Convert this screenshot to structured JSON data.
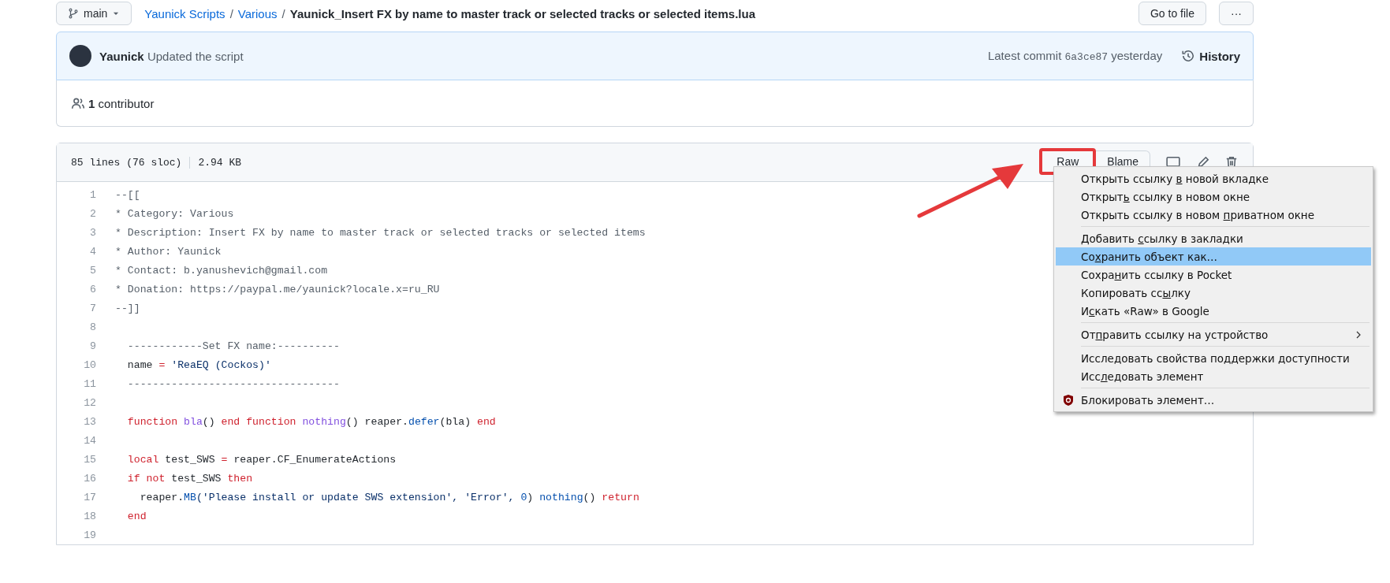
{
  "top_bar": {
    "branch": "main",
    "breadcrumb": [
      {
        "label": "Yaunick Scripts",
        "kind": "link"
      },
      {
        "label": "/",
        "kind": "separator"
      },
      {
        "label": "Various",
        "kind": "link"
      },
      {
        "label": "/",
        "kind": "separator"
      },
      {
        "label": "Yaunick_Insert FX by name to master track or selected tracks or selected items.lua",
        "kind": "current"
      }
    ],
    "goto_button": "Go to file",
    "more_button": "···"
  },
  "commit": {
    "author": "Yaunick",
    "message": "Updated the script",
    "latest_label": "Latest commit",
    "sha": "6a3ce87",
    "time": "yesterday",
    "history": "History"
  },
  "contributors": {
    "count": "1",
    "label": "contributor"
  },
  "file": {
    "lines_info": "85 lines (76 sloc)",
    "size": "2.94 KB",
    "buttons": [
      {
        "label": "Raw",
        "highlighted": true
      },
      {
        "label": "Blame",
        "highlighted": false
      }
    ],
    "code": [
      {
        "number": "1",
        "tokens": [
          {
            "t": "--[[",
            "kind": "comment"
          }
        ]
      },
      {
        "number": "2",
        "tokens": [
          {
            "t": "* Category: Various",
            "kind": "comment"
          }
        ]
      },
      {
        "number": "3",
        "tokens": [
          {
            "t": "* Description: Insert FX by name to master track or selected tracks or selected items",
            "kind": "comment"
          }
        ]
      },
      {
        "number": "4",
        "tokens": [
          {
            "t": "* Author: Yaunick",
            "kind": "comment"
          }
        ]
      },
      {
        "number": "5",
        "tokens": [
          {
            "t": "* Contact: b.yanushevich@gmail.com",
            "kind": "comment"
          }
        ]
      },
      {
        "number": "6",
        "tokens": [
          {
            "t": "* Donation: https://paypal.me/yaunick?locale.x=ru_RU",
            "kind": "comment"
          }
        ]
      },
      {
        "number": "7",
        "tokens": [
          {
            "t": "--]]",
            "kind": "comment"
          }
        ]
      },
      {
        "number": "8"
      },
      {
        "number": "9",
        "tokens": [
          {
            "t": "  ------------Set FX name:----------",
            "kind": "comment"
          }
        ]
      },
      {
        "number": "10",
        "tokens": [
          {
            "t": "  name ",
            "kind": "plain"
          },
          {
            "t": "=",
            "kind": "keyword"
          },
          {
            "t": " 'ReaEQ (Cockos)'",
            "kind": "string"
          }
        ]
      },
      {
        "number": "11",
        "tokens": [
          {
            "t": "  ----------------------------------",
            "kind": "comment"
          }
        ]
      },
      {
        "number": "12"
      },
      {
        "number": "13",
        "tokens": [
          {
            "t": "  function",
            "kind": "keyword"
          },
          {
            "t": " bla",
            "kind": "entity"
          },
          {
            "t": "() ",
            "kind": "plain"
          },
          {
            "t": "end function",
            "kind": "keyword"
          },
          {
            "t": " nothing",
            "kind": "entity"
          },
          {
            "t": "() reaper.",
            "kind": "plain"
          },
          {
            "t": "defer",
            "kind": "constant"
          },
          {
            "t": "(bla) ",
            "kind": "plain"
          },
          {
            "t": "end",
            "kind": "keyword"
          }
        ]
      },
      {
        "number": "14"
      },
      {
        "number": "15",
        "tokens": [
          {
            "t": "  local",
            "kind": "keyword"
          },
          {
            "t": " test_SWS ",
            "kind": "plain"
          },
          {
            "t": "=",
            "kind": "keyword"
          },
          {
            "t": " reaper.CF_EnumerateActions",
            "kind": "plain"
          }
        ]
      },
      {
        "number": "16",
        "tokens": [
          {
            "t": "  if not",
            "kind": "keyword"
          },
          {
            "t": " test_SWS ",
            "kind": "plain"
          },
          {
            "t": "then",
            "kind": "keyword"
          }
        ]
      },
      {
        "number": "17",
        "tokens": [
          {
            "t": "    reaper.",
            "kind": "plain"
          },
          {
            "t": "MB",
            "kind": "constant"
          },
          {
            "t": "('Please install or update SWS extension', 'Error', ",
            "kind": "string"
          },
          {
            "t": "0",
            "kind": "constant"
          },
          {
            "t": ") ",
            "kind": "plain"
          },
          {
            "t": "nothing",
            "kind": "constant"
          },
          {
            "t": "() ",
            "kind": "plain"
          },
          {
            "t": "return",
            "kind": "keyword"
          }
        ]
      },
      {
        "number": "18",
        "tokens": [
          {
            "t": "  end",
            "kind": "keyword"
          }
        ]
      },
      {
        "number": "19"
      }
    ]
  },
  "context_menu": [
    {
      "kind": "item",
      "pre": "Открыть ссылку ",
      "key": "в",
      "post": " новой вкладке",
      "selected": false,
      "submenu": false,
      "icon": false
    },
    {
      "kind": "item",
      "pre": "Открыт",
      "key": "ь",
      "post": " ссылку в новом окне",
      "selected": false,
      "submenu": false,
      "icon": false
    },
    {
      "kind": "item",
      "pre": "Открыть ссылку в новом ",
      "key": "п",
      "post": "риватном окне",
      "selected": false,
      "submenu": false,
      "icon": false
    },
    {
      "kind": "separator"
    },
    {
      "kind": "item",
      "pre": "Добавить ",
      "key": "с",
      "post": "сылку в закладки",
      "selected": false,
      "submenu": false,
      "icon": false
    },
    {
      "kind": "item",
      "pre": "Со",
      "key": "х",
      "post": "ранить объект как…",
      "selected": true,
      "submenu": false,
      "icon": false
    },
    {
      "kind": "item",
      "pre": "Сохра",
      "key": "н",
      "post": "ить ссылку в Pocket",
      "selected": false,
      "submenu": false,
      "icon": false
    },
    {
      "kind": "item",
      "pre": "Копировать сс",
      "key": "ы",
      "post": "лку",
      "selected": false,
      "submenu": false,
      "icon": false
    },
    {
      "kind": "item",
      "pre": "И",
      "key": "с",
      "post": "кать «Raw» в Google",
      "selected": false,
      "submenu": false,
      "icon": false
    },
    {
      "kind": "separator"
    },
    {
      "kind": "item",
      "pre": "От",
      "key": "п",
      "post": "равить ссылку на устройство",
      "selected": false,
      "submenu": true,
      "icon": false
    },
    {
      "kind": "separator"
    },
    {
      "kind": "item",
      "pre": "Исследовать свойства поддержки доступности",
      "selected": false,
      "submenu": false,
      "icon": false
    },
    {
      "kind": "item",
      "pre": "Исс",
      "key": "л",
      "post": "едовать элемент",
      "selected": false,
      "submenu": false,
      "icon": false
    },
    {
      "kind": "separator"
    },
    {
      "kind": "item",
      "pre": "Блокировать элемент…",
      "selected": false,
      "submenu": false,
      "icon": true
    }
  ]
}
